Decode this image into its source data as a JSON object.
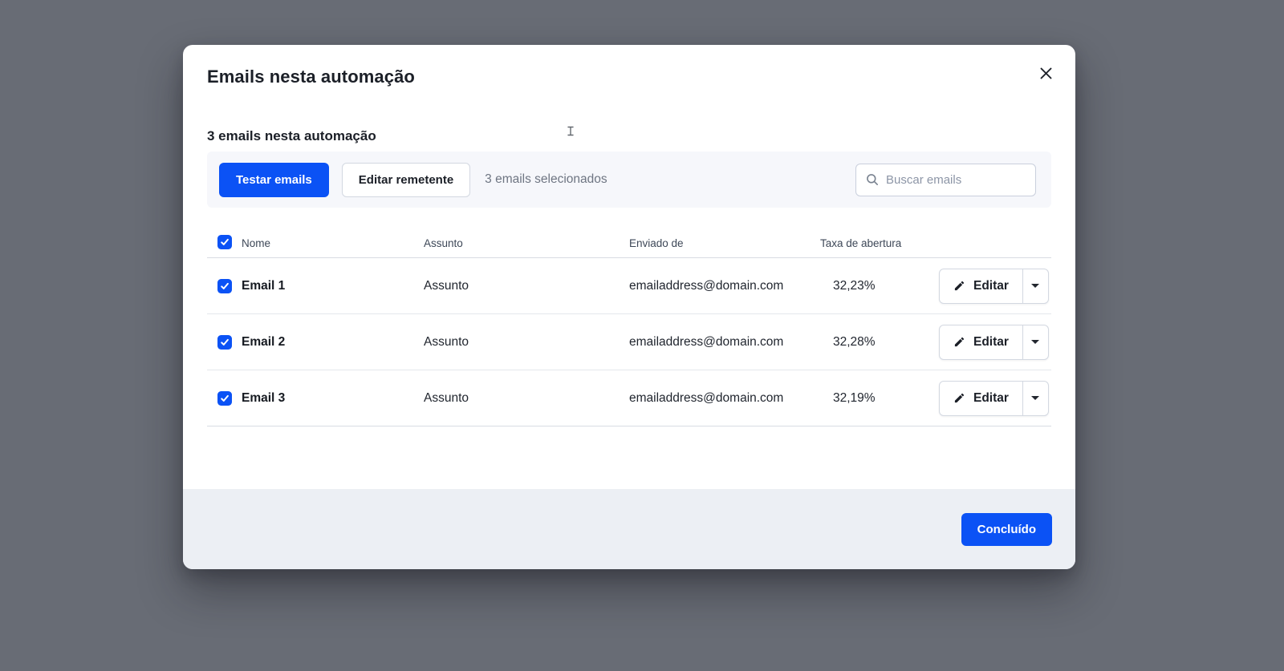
{
  "modal": {
    "title": "Emails nesta automação",
    "subtitle": "3 emails nesta automação"
  },
  "toolbar": {
    "test_emails_button": "Testar emails",
    "edit_sender_button": "Editar remetente",
    "selection_status": "3 emails selecionados",
    "search_placeholder": "Buscar emails"
  },
  "table": {
    "select_all_checked": true,
    "headers": {
      "name": "Nome",
      "subject": "Assunto",
      "sent_from": "Enviado de",
      "open_rate": "Taxa de abertura"
    },
    "edit_button_label": "Editar",
    "rows": [
      {
        "checked": true,
        "name": "Email 1",
        "subject": "Assunto",
        "sent_from": "emailaddress@domain.com",
        "open_rate": "32,23%"
      },
      {
        "checked": true,
        "name": "Email 2",
        "subject": "Assunto",
        "sent_from": "emailaddress@domain.com",
        "open_rate": "32,28%"
      },
      {
        "checked": true,
        "name": "Email 3",
        "subject": "Assunto",
        "sent_from": "emailaddress@domain.com",
        "open_rate": "32,19%"
      }
    ]
  },
  "footer": {
    "done_button": "Concluído"
  },
  "colors": {
    "accent_blue": "#0B52F5",
    "overlay_gray": "#686C75",
    "toolbar_bg": "#F6F7FB",
    "footer_bg": "#ECEFF4"
  }
}
